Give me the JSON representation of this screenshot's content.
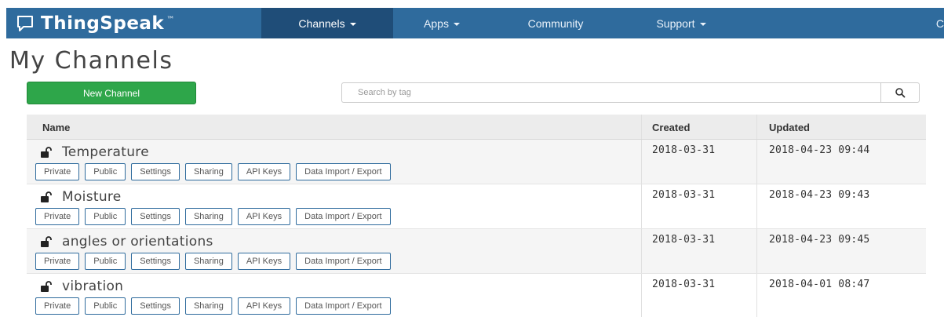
{
  "nav": {
    "brand": "ThingSpeak",
    "brand_tm": "™",
    "items": [
      {
        "label": "Channels"
      },
      {
        "label": "Apps"
      },
      {
        "label": "Community"
      },
      {
        "label": "Support"
      }
    ],
    "cutoff": "C"
  },
  "page": {
    "title": "My Channels",
    "new_channel_label": "New Channel"
  },
  "search": {
    "placeholder": "Search by tag"
  },
  "table": {
    "headers": {
      "name": "Name",
      "created": "Created",
      "updated": "Updated"
    },
    "row_buttons": [
      "Private",
      "Public",
      "Settings",
      "Sharing",
      "API Keys",
      "Data Import / Export"
    ],
    "rows": [
      {
        "name": "Temperature",
        "created": "2018-03-31",
        "updated": "2018-04-23 09:44"
      },
      {
        "name": "Moisture",
        "created": "2018-03-31",
        "updated": "2018-04-23 09:43"
      },
      {
        "name": "angles or orientations",
        "created": "2018-03-31",
        "updated": "2018-04-23 09:45"
      },
      {
        "name": "vibration",
        "created": "2018-03-31",
        "updated": "2018-04-01 08:47"
      }
    ]
  },
  "colors": {
    "navbar": "#2f6b9d",
    "navbar_active": "#1f4d78",
    "new_button": "#2ea64a"
  }
}
